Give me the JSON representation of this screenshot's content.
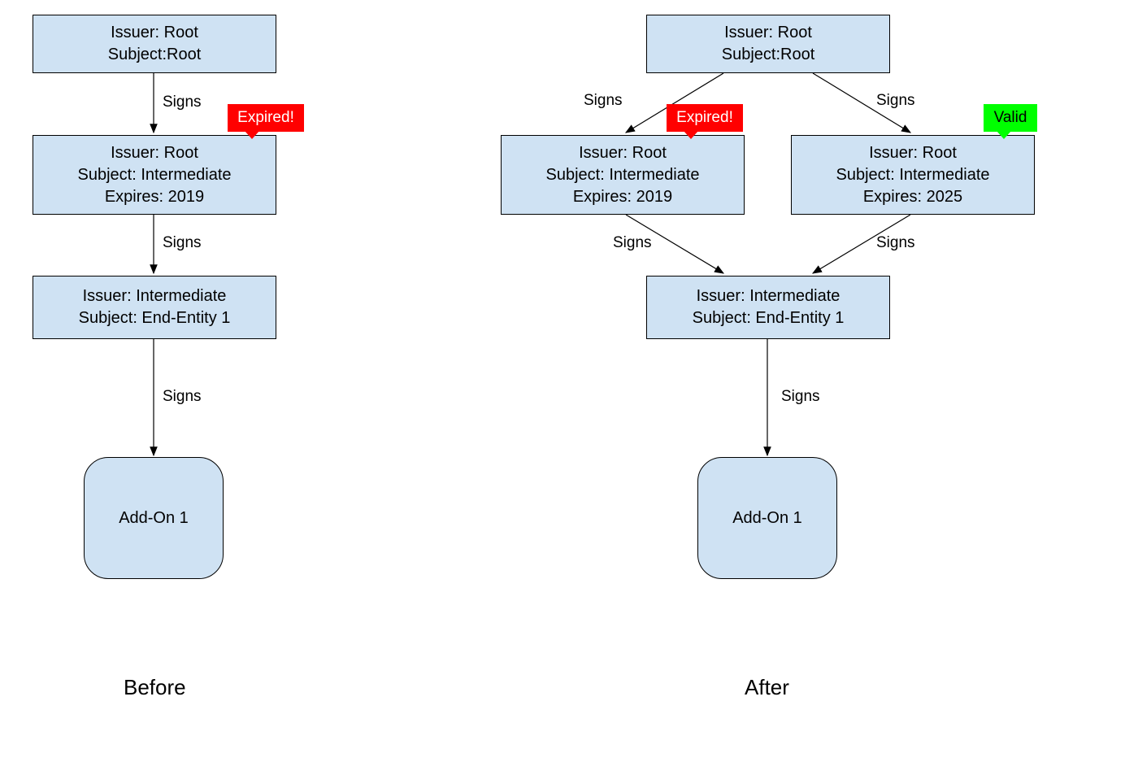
{
  "labels": {
    "signs": "Signs",
    "before": "Before",
    "after": "After"
  },
  "badges": {
    "expired": "Expired!",
    "valid": "Valid"
  },
  "before": {
    "root": {
      "l1": "Issuer: Root",
      "l2": "Subject:Root"
    },
    "intermediate": {
      "l1": "Issuer: Root",
      "l2": "Subject: Intermediate",
      "l3": "Expires: 2019"
    },
    "endentity": {
      "l1": "Issuer: Intermediate",
      "l2": "Subject: End-Entity 1"
    },
    "addon": {
      "label": "Add-On 1"
    }
  },
  "after": {
    "root": {
      "l1": "Issuer: Root",
      "l2": "Subject:Root"
    },
    "intermediate_expired": {
      "l1": "Issuer: Root",
      "l2": "Subject: Intermediate",
      "l3": "Expires: 2019"
    },
    "intermediate_valid": {
      "l1": "Issuer: Root",
      "l2": "Subject: Intermediate",
      "l3": "Expires: 2025"
    },
    "endentity": {
      "l1": "Issuer: Intermediate",
      "l2": "Subject: End-Entity 1"
    },
    "addon": {
      "label": "Add-On 1"
    }
  },
  "colors": {
    "nodeFill": "#cfe2f3",
    "expired": "#ff0000",
    "valid": "#00ff00"
  }
}
